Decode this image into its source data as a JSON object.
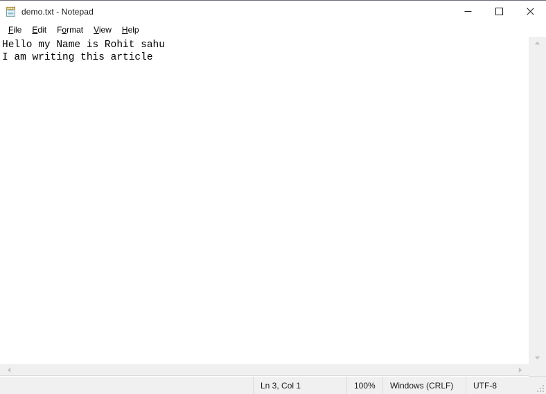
{
  "window": {
    "title": "demo.txt - Notepad",
    "app_icon": "notepad-icon",
    "controls": {
      "minimize": "minimize-icon",
      "maximize": "maximize-icon",
      "close": "close-icon"
    }
  },
  "menubar": {
    "items": [
      {
        "label": "File",
        "access_key": "F"
      },
      {
        "label": "Edit",
        "access_key": "E"
      },
      {
        "label": "Format",
        "access_key": "o"
      },
      {
        "label": "View",
        "access_key": "V"
      },
      {
        "label": "Help",
        "access_key": "H"
      }
    ]
  },
  "editor": {
    "lines": [
      "Hello my Name is Rohit sahu",
      "I am writing this article"
    ]
  },
  "scrollbars": {
    "vertical": {
      "up": "scroll-up-arrow-icon",
      "down": "scroll-down-arrow-icon"
    },
    "horizontal": {
      "left": "scroll-left-arrow-icon",
      "right": "scroll-right-arrow-icon"
    }
  },
  "statusbar": {
    "cursor_position": "Ln 3, Col 1",
    "zoom": "100%",
    "line_ending": "Windows (CRLF)",
    "encoding": "UTF-8"
  },
  "colors": {
    "window_background": "#ffffff",
    "chrome_background": "#f0f0f0",
    "separator": "#dcdcdc",
    "text": "#000000",
    "title_border": "#6b6b76",
    "scroll_arrow": "#c2c2c2"
  }
}
